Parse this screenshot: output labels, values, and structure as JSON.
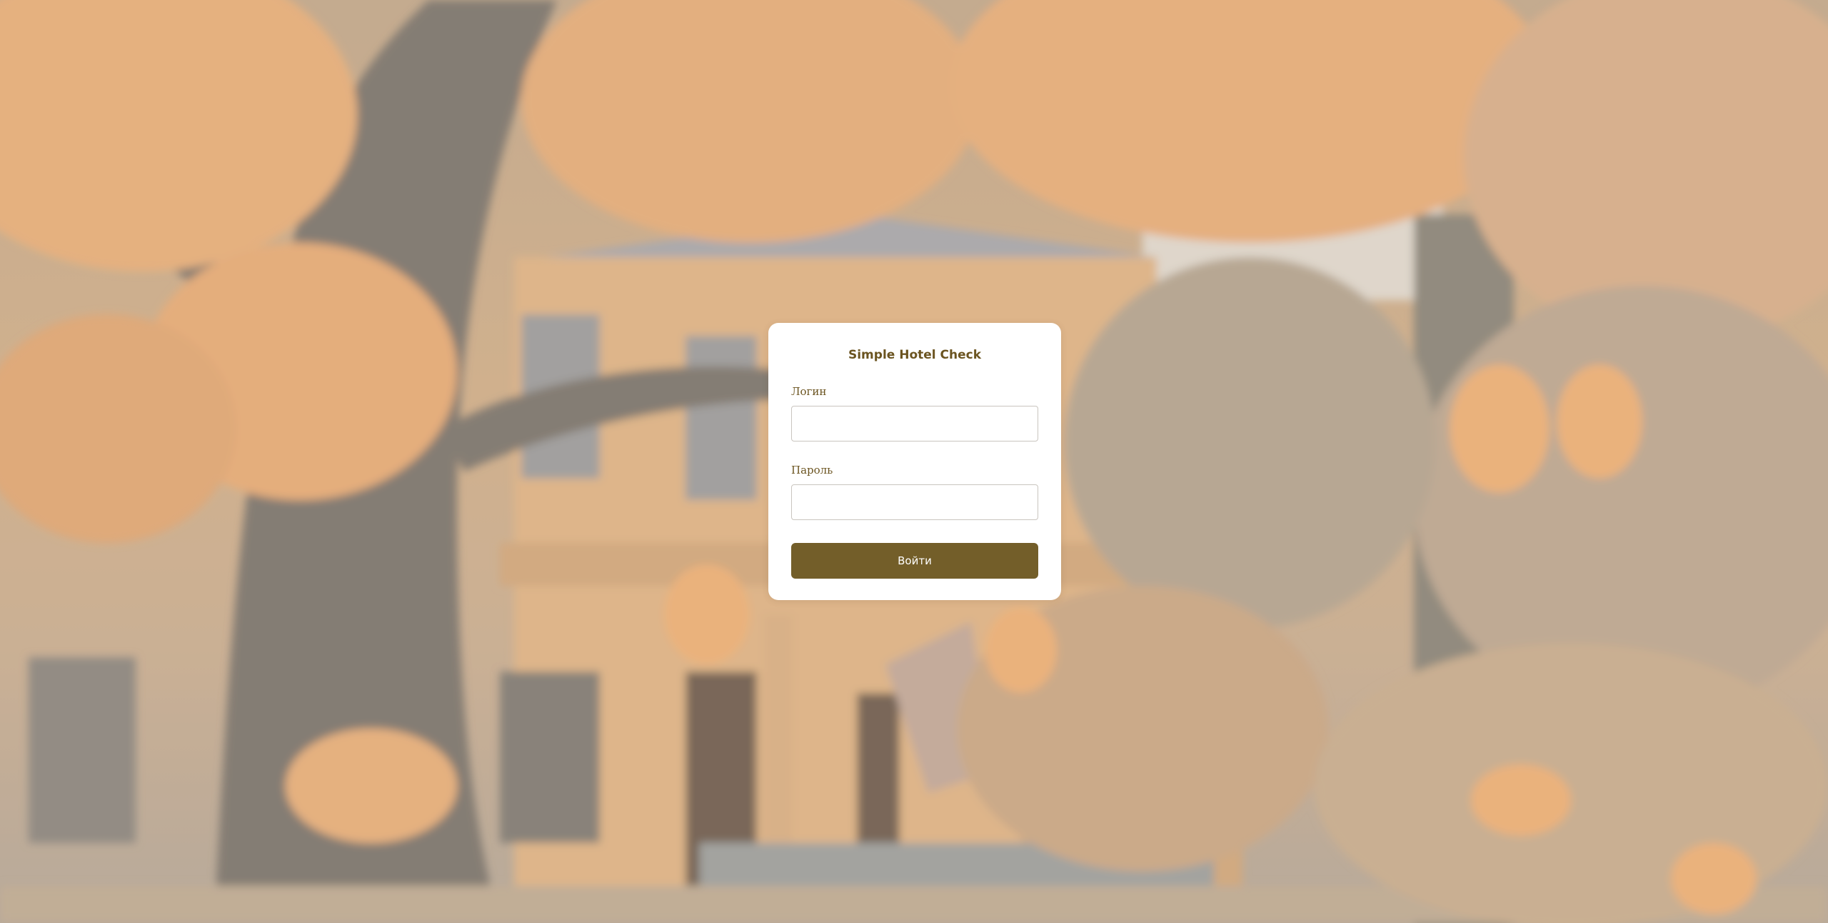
{
  "app": {
    "title": "Simple Hotel Check"
  },
  "login_form": {
    "login_label": "Логин",
    "login_value": "",
    "password_label": "Пароль",
    "password_value": "",
    "submit_label": "Войти"
  },
  "colors": {
    "accent": "#735e29",
    "text": "#6b5420",
    "card_background": "#ffffff"
  }
}
